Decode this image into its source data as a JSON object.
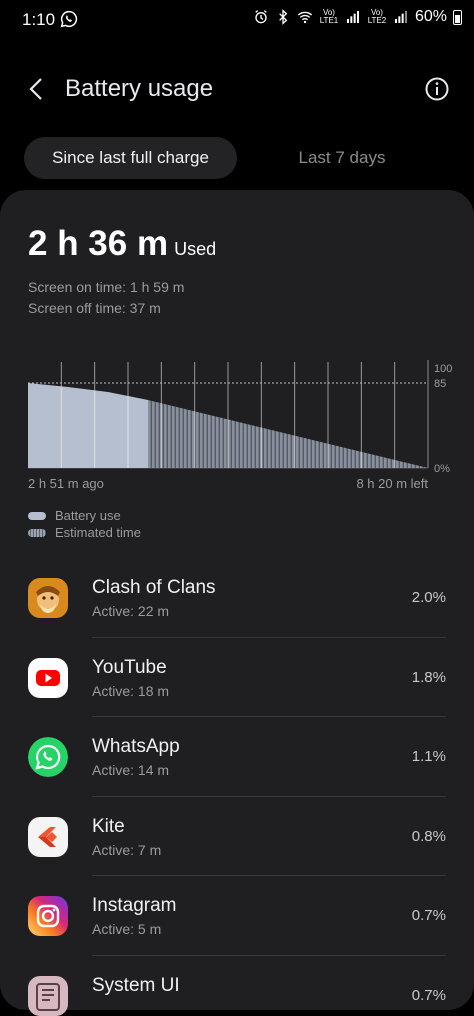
{
  "status_bar": {
    "time": "1:10",
    "net1": "Vo) LTE1",
    "net2": "Vo) LTE2",
    "battery_percent": "60%"
  },
  "header": {
    "title": "Battery usage",
    "back_icon": "chevron-left-icon",
    "info_icon": "info-icon"
  },
  "tabs": [
    {
      "label": "Since last full charge",
      "selected": true
    },
    {
      "label": "Last 7 days",
      "selected": false
    }
  ],
  "summary": {
    "used_value": "2 h 36 m",
    "used_label": "Used",
    "screen_on": "Screen on time: 1 h 59 m",
    "screen_off": "Screen off time: 37 m"
  },
  "chart_data": {
    "type": "area",
    "x_start_label": "2 h 51 m ago",
    "x_end_label": "8 h 20 m left",
    "y_ticks": [
      "100",
      "85",
      "0%"
    ],
    "ylim": [
      0,
      100
    ],
    "series": [
      {
        "name": "Battery use",
        "x": [
          0,
          0.1,
          0.2,
          0.3
        ],
        "values": [
          85,
          81,
          76,
          68
        ]
      },
      {
        "name": "Estimated time",
        "x": [
          0.3,
          1.0
        ],
        "values": [
          68,
          0
        ]
      }
    ],
    "colors": {
      "battery_use": "#b5bfcf",
      "estimated": "#9aa3b3"
    }
  },
  "legend": {
    "battery_use": "Battery use",
    "estimated": "Estimated time"
  },
  "apps": [
    {
      "name": "Clash of Clans",
      "active": "Active: 22 m",
      "percent": "2.0%",
      "icon": "clash-of-clans-icon"
    },
    {
      "name": "YouTube",
      "active": "Active: 18 m",
      "percent": "1.8%",
      "icon": "youtube-icon"
    },
    {
      "name": "WhatsApp",
      "active": "Active: 14 m",
      "percent": "1.1%",
      "icon": "whatsapp-icon"
    },
    {
      "name": "Kite",
      "active": "Active: 7 m",
      "percent": "0.8%",
      "icon": "kite-icon"
    },
    {
      "name": "Instagram",
      "active": "Active: 5 m",
      "percent": "0.7%",
      "icon": "instagram-icon"
    },
    {
      "name": "System UI",
      "active": "",
      "percent": "0.7%",
      "icon": "system-ui-icon"
    }
  ]
}
